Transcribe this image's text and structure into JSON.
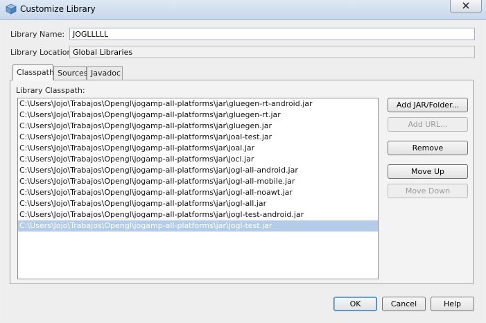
{
  "window": {
    "title": "Customize Library"
  },
  "form": {
    "library_name_label": "Library Name:",
    "library_name_value": "JOGLLLLL",
    "library_location_label": "Library Location:",
    "library_location_value": "Global Libraries"
  },
  "tabs": [
    {
      "label": "Classpath",
      "active": true
    },
    {
      "label": "Sources",
      "active": false
    },
    {
      "label": "Javadoc",
      "active": false
    }
  ],
  "classpath": {
    "label": "Library Classpath:",
    "items": [
      "C:\\Users\\Jojo\\Trabajos\\Opengl\\jogamp-all-platforms\\jar\\gluegen-rt-android.jar",
      "C:\\Users\\Jojo\\Trabajos\\Opengl\\jogamp-all-platforms\\jar\\gluegen-rt.jar",
      "C:\\Users\\Jojo\\Trabajos\\Opengl\\jogamp-all-platforms\\jar\\gluegen.jar",
      "C:\\Users\\Jojo\\Trabajos\\Opengl\\jogamp-all-platforms\\jar\\joal-test.jar",
      "C:\\Users\\Jojo\\Trabajos\\Opengl\\jogamp-all-platforms\\jar\\joal.jar",
      "C:\\Users\\Jojo\\Trabajos\\Opengl\\jogamp-all-platforms\\jar\\jocl.jar",
      "C:\\Users\\Jojo\\Trabajos\\Opengl\\jogamp-all-platforms\\jar\\jogl-all-android.jar",
      "C:\\Users\\Jojo\\Trabajos\\Opengl\\jogamp-all-platforms\\jar\\jogl-all-mobile.jar",
      "C:\\Users\\Jojo\\Trabajos\\Opengl\\jogamp-all-platforms\\jar\\jogl-all-noawt.jar",
      "C:\\Users\\Jojo\\Trabajos\\Opengl\\jogamp-all-platforms\\jar\\jogl-all.jar",
      "C:\\Users\\Jojo\\Trabajos\\Opengl\\jogamp-all-platforms\\jar\\jogl-test-android.jar",
      "C:\\Users\\Jojo\\Trabajos\\Opengl\\jogamp-all-platforms\\jar\\jogl-test.jar"
    ],
    "selected_index": 11
  },
  "side_buttons": {
    "add_jar": "Add JAR/Folder...",
    "add_url": "Add URL...",
    "remove": "Remove",
    "move_up": "Move Up",
    "move_down": "Move Down"
  },
  "dialog_buttons": {
    "ok": "OK",
    "cancel": "Cancel",
    "help": "Help"
  },
  "icons": {
    "app": "cube-icon",
    "close": "close-icon"
  },
  "colors": {
    "selection": "#b3cde8",
    "titlebar": "#c7d7ea"
  }
}
